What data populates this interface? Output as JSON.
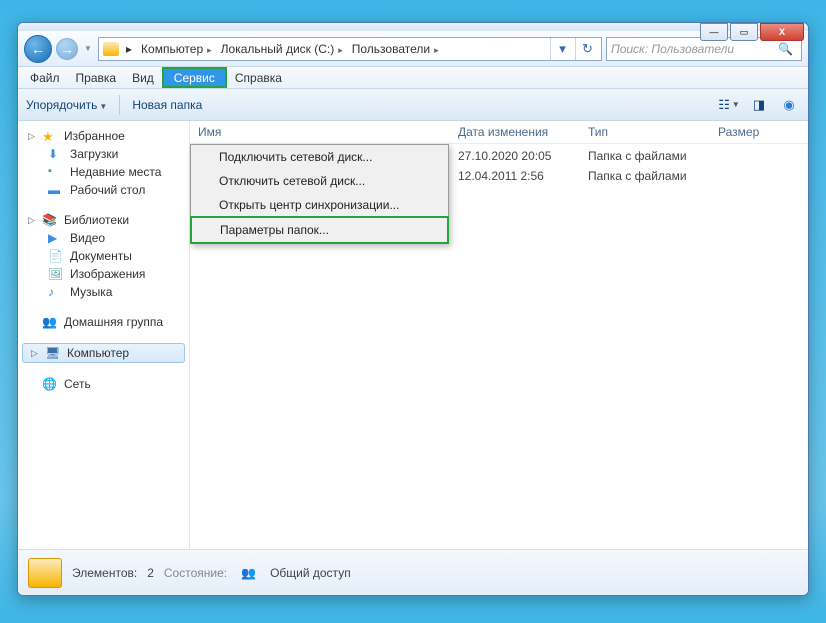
{
  "window_controls": {
    "min": "—",
    "max": "▭",
    "close": "X"
  },
  "nav": {
    "back": "←",
    "fwd": "→"
  },
  "breadcrumb": {
    "items": [
      "Компьютер",
      "Локальный диск (C:)",
      "Пользователи"
    ]
  },
  "search": {
    "placeholder": "Поиск: Пользователи"
  },
  "menubar": {
    "file": "Файл",
    "edit": "Правка",
    "view": "Вид",
    "service": "Сервис",
    "help": "Справка"
  },
  "service_menu": {
    "items": [
      "Подключить сетевой диск...",
      "Отключить сетевой диск...",
      "Открыть центр синхронизации...",
      "Параметры папок..."
    ]
  },
  "toolbar": {
    "organize": "Упорядочить",
    "new_folder": "Новая папка"
  },
  "sidebar": {
    "favorites": {
      "title": "Избранное",
      "items": [
        "Загрузки",
        "Недавние места",
        "Рабочий стол"
      ]
    },
    "libraries": {
      "title": "Библиотеки",
      "items": [
        "Видео",
        "Документы",
        "Изображения",
        "Музыка"
      ]
    },
    "homegroup": "Домашняя группа",
    "computer": "Компьютер",
    "network": "Сеть"
  },
  "columns": {
    "name": "Имя",
    "date": "Дата изменения",
    "type": "Тип",
    "size": "Размер"
  },
  "files": [
    {
      "date": "27.10.2020 20:05",
      "type": "Папка с файлами"
    },
    {
      "date": "12.04.2011 2:56",
      "type": "Папка с файлами"
    }
  ],
  "statusbar": {
    "elements_label": "Элементов:",
    "elements_count": "2",
    "state_label": "Состояние:",
    "shared": "Общий доступ"
  }
}
